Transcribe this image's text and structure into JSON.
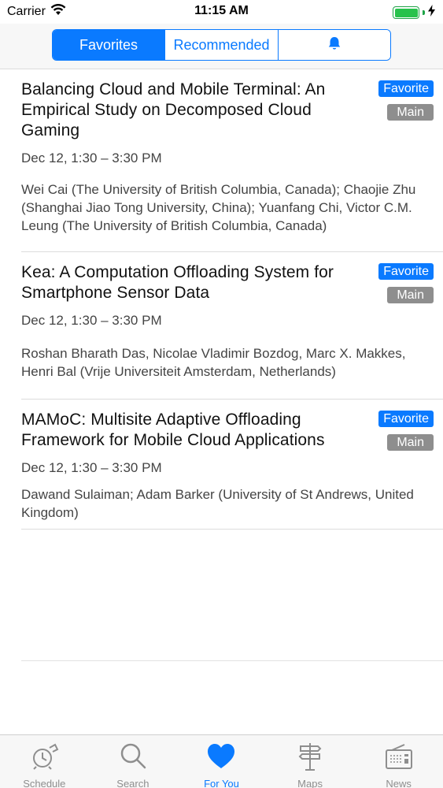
{
  "status_bar": {
    "carrier": "Carrier",
    "time": "11:15 AM"
  },
  "segments": [
    {
      "label": "Favorites",
      "active": true
    },
    {
      "label": "Recommended",
      "active": false
    },
    {
      "icon": "bell-icon",
      "active": false
    }
  ],
  "sessions": [
    {
      "title": "Balancing Cloud and Mobile Terminal: An Empirical Study on Decomposed Cloud Gaming",
      "time": "Dec 12, 1:30 – 3:30 PM",
      "authors": "Wei Cai (The University of British Columbia, Canada); Chaojie Zhu (Shanghai Jiao Tong University, China); Yuanfang Chi, Victor C.M. Leung (The University of British Columbia, Canada)",
      "badge_favorite": "Favorite",
      "badge_track": "Main"
    },
    {
      "title": "Kea: A Computation Offloading System for Smartphone Sensor Data",
      "time": "Dec 12, 1:30 – 3:30 PM",
      "authors": "Roshan Bharath Das, Nicolae Vladimir Bozdog, Marc X. Makkes, Henri Bal (Vrije Universiteit Amsterdam, Netherlands)",
      "badge_favorite": "Favorite",
      "badge_track": "Main"
    },
    {
      "title": "MAMoC: Multisite Adaptive Offloading Framework for Mobile Cloud Applications",
      "time": "Dec 12, 1:30 – 3:30 PM",
      "authors": "Dawand Sulaiman; Adam Barker (University of St Andrews, United Kingdom)",
      "badge_favorite": "Favorite",
      "badge_track": "Main"
    }
  ],
  "tabs": [
    {
      "label": "Schedule",
      "icon": "clock-icon",
      "active": false
    },
    {
      "label": "Search",
      "icon": "search-icon",
      "active": false
    },
    {
      "label": "For You",
      "icon": "heart-icon",
      "active": true
    },
    {
      "label": "Maps",
      "icon": "signpost-icon",
      "active": false
    },
    {
      "label": "News",
      "icon": "radio-icon",
      "active": false
    }
  ],
  "colors": {
    "accent": "#0a7aff",
    "badge_gray": "#8e8e8e",
    "tab_inactive": "#8e8e8e",
    "battery": "#27c24c"
  }
}
